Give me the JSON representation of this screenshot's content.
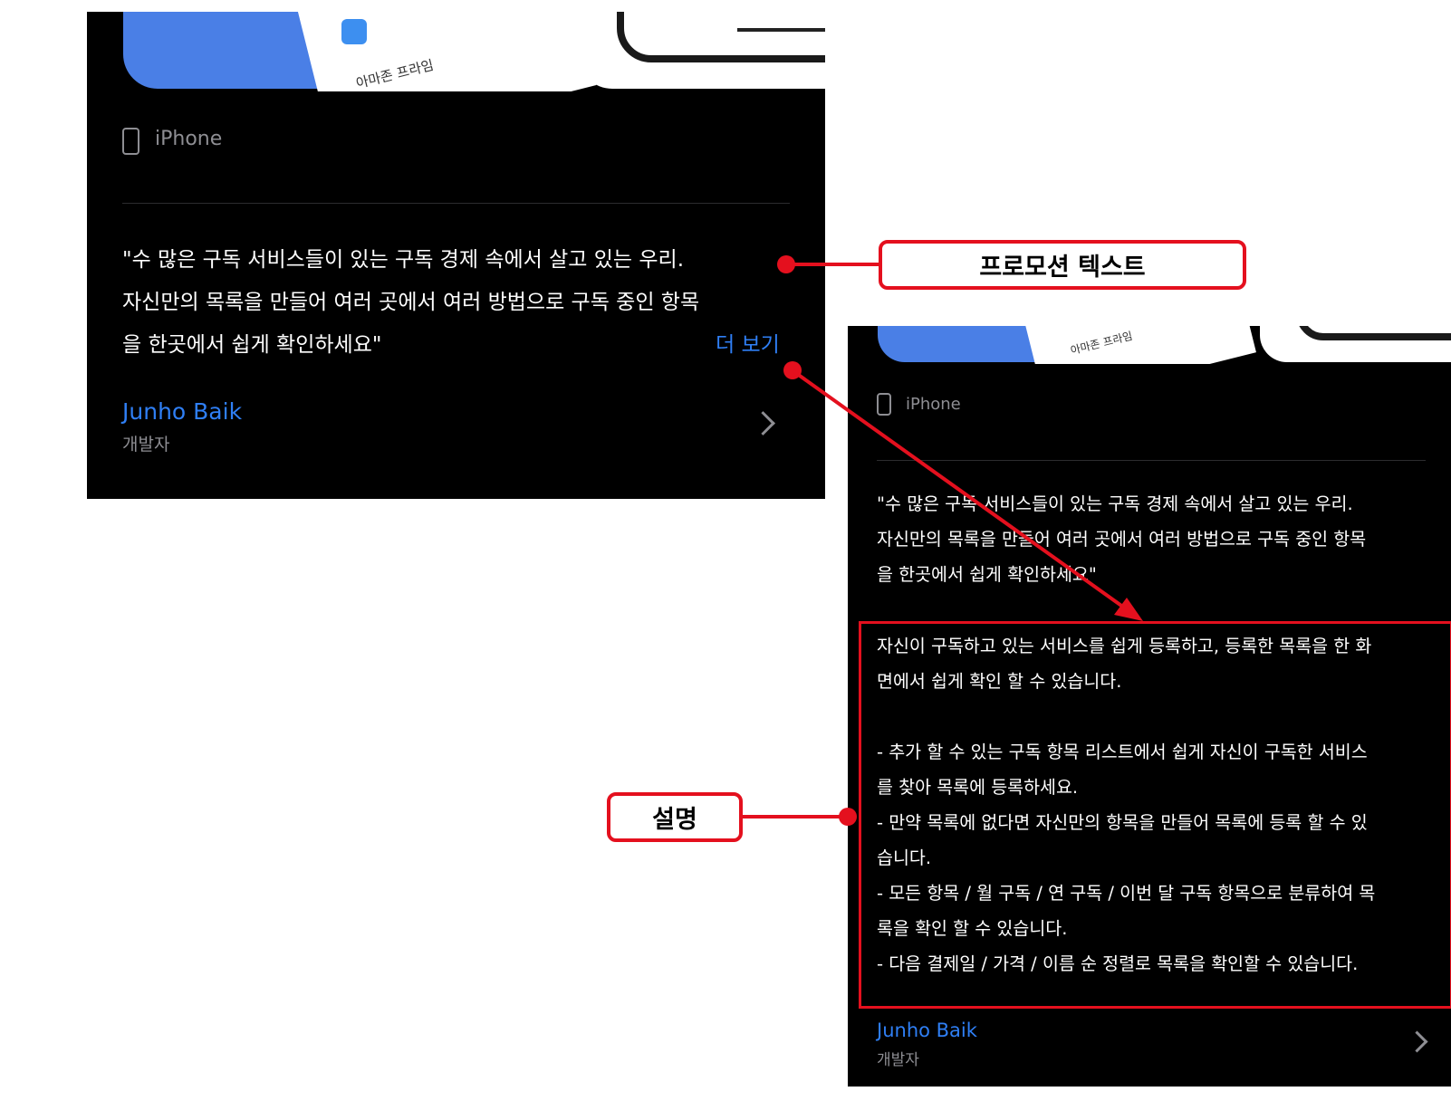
{
  "left_panel": {
    "screenshot_caption": "아마존 프라임",
    "device_label": "iPhone",
    "promo_lines": [
      "\"수 많은 구독 서비스들이 있는 구독 경제 속에서 살고 있는 우리.",
      " 자신만의 목록을 만들어 여러 곳에서 여러 방법으로 구독 중인 항목",
      "을 한곳에서 쉽게 확인하세요\""
    ],
    "more_label": "더 보기",
    "developer_name": "Junho Baik",
    "developer_role": "개발자"
  },
  "right_panel": {
    "screenshot_caption": "아마존 프라임",
    "device_label": "iPhone",
    "promo_lines": [
      "\"수 많은 구독 서비스들이 있는 구독 경제 속에서 살고 있는 우리.",
      " 자신만의 목록을 만들어 여러 곳에서 여러 방법으로 구독 중인 항목",
      "을 한곳에서 쉽게 확인하세요\""
    ],
    "description_lines": [
      "자신이 구독하고 있는 서비스를 쉽게 등록하고, 등록한 목록을 한 화",
      "면에서 쉽게 확인 할 수 있습니다.",
      "",
      "- 추가 할 수 있는 구독 항목 리스트에서 쉽게 자신이 구독한 서비스",
      "를 찾아 목록에 등록하세요.",
      "- 만약 목록에 없다면 자신만의 항목을 만들어 목록에 등록 할 수 있",
      "습니다.",
      "- 모든 항목 / 월 구독 / 연 구독 / 이번 달 구독 항목으로 분류하여 목",
      "록을 확인 할 수 있습니다.",
      "- 다음 결제일 / 가격 / 이름 순 정렬로 목록을 확인할 수 있습니다."
    ],
    "developer_name": "Junho Baik",
    "developer_role": "개발자"
  },
  "callouts": {
    "promo_text": "프로모션 텍스트",
    "description": "설명"
  },
  "colors": {
    "accent_blue": "#2f7ff5",
    "annotation_red": "#e4101e",
    "panel_bg": "#000000",
    "muted_gray": "#8e8e93"
  }
}
